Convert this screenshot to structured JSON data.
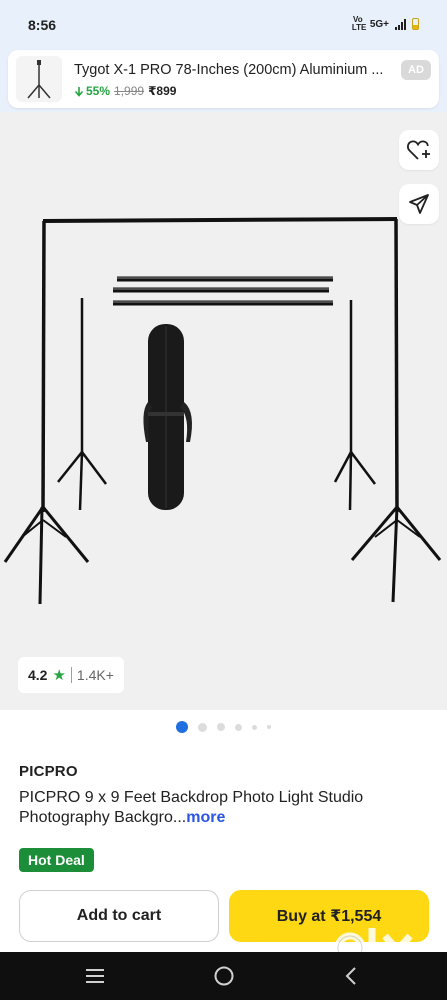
{
  "status_bar": {
    "time": "8:56",
    "volte": "Vo LTE",
    "network": "5G+"
  },
  "ad": {
    "title": "Tygot X-1 PRO 78-Inches (200cm) Aluminium ...",
    "discount": "55%",
    "mrp": "1,999",
    "price": "₹899",
    "badge": "AD"
  },
  "product": {
    "rating": "4.2",
    "rating_count": "1.4K+",
    "carousel_total": 6,
    "carousel_active": 0,
    "brand": "PICPRO",
    "title": "PICPRO 9 x 9 Feet Backdrop Photo Light Studio Photography Backgro...",
    "more_label": "more",
    "tag": "Hot Deal"
  },
  "actions": {
    "add_to_cart": "Add to cart",
    "buy_at": "Buy at ₹1,554"
  },
  "watermark": "OLX",
  "icons": {
    "wishlist": "heart-plus-icon",
    "share": "share-icon",
    "star": "star-icon",
    "nav_menu": "menu-icon",
    "nav_home": "home-circle-icon",
    "nav_back": "back-chevron-icon"
  },
  "colors": {
    "accent_green": "#26a541",
    "hot_deal_bg": "#1c8e3a",
    "buy_button": "#ffd814",
    "link_blue": "#2a55e5",
    "active_dot": "#1f6fe0"
  }
}
